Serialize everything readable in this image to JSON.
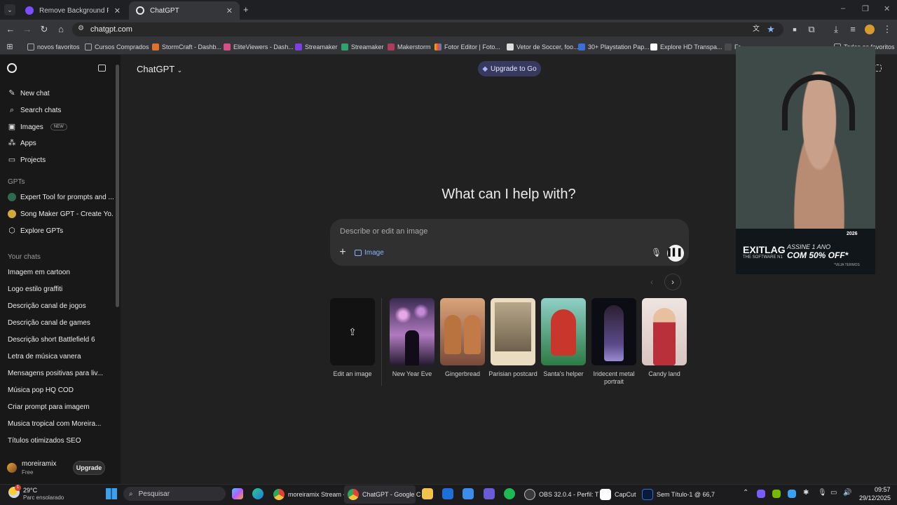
{
  "browser": {
    "tabs": [
      {
        "title": "Remove Background From Pho",
        "favicon_color": "#7c4dff",
        "active": false
      },
      {
        "title": "ChatGPT",
        "favicon_color": "#e8e8e8",
        "active": true
      }
    ],
    "new_tab": "+",
    "url": "chatgpt.com",
    "bookmarks": [
      {
        "label": "novos favoritos",
        "color": "#5f6368",
        "folder": true
      },
      {
        "label": "Cursos Comprados",
        "color": "#5f6368",
        "folder": true
      },
      {
        "label": "StormCraft - Dashb...",
        "color": "#e0712b"
      },
      {
        "label": "EliteViewers - Dash...",
        "color": "#d94d8a"
      },
      {
        "label": "Streamaker",
        "color": "#7b3fe4"
      },
      {
        "label": "Streamaker",
        "color": "#2fa36b"
      },
      {
        "label": "Makerstorm",
        "color": "#b03a5b"
      },
      {
        "label": "Fotor Editor | Foto...",
        "color": "#f2b705"
      },
      {
        "label": "Vetor de Soccer, foo...",
        "color": "#222222"
      },
      {
        "label": "30+ Playstation Pap...",
        "color": "#3a6fd8"
      },
      {
        "label": "Explore HD Transpa...",
        "color": "#ffffff"
      },
      {
        "label": "Fr...",
        "color": "#4a4a4a"
      },
      {
        "label": "Todos os favoritos",
        "color": "#5f6368",
        "folder": true
      }
    ]
  },
  "sidebar": {
    "nav": [
      {
        "label": "New chat",
        "icon": "edit-icon"
      },
      {
        "label": "Search chats",
        "icon": "search-icon"
      },
      {
        "label": "Images",
        "icon": "images-icon",
        "badge": "NEW"
      },
      {
        "label": "Apps",
        "icon": "apps-icon"
      },
      {
        "label": "Projects",
        "icon": "folder-icon"
      }
    ],
    "gpts_header": "GPTs",
    "gpts": [
      {
        "label": "Expert Tool for prompts and ...",
        "color": "#2c6b4f"
      },
      {
        "label": "Song Maker GPT - Create Yo...",
        "color": "#d4a73a"
      },
      {
        "label": "Explore GPTs",
        "color": ""
      }
    ],
    "chats_header": "Your chats",
    "chats": [
      "Imagem em cartoon",
      "Logo estilo graffiti",
      "Descrição canal de jogos",
      "Descrição canal de games",
      "Descrição short Battlefield 6",
      "Letra de música vanera",
      "Mensagens positivas para liv...",
      "Música pop HQ COD",
      "Criar prompt para imagem",
      "Musica tropical com Moreira...",
      "Títulos otimizados SEO"
    ],
    "user": {
      "name": "moreiramix",
      "plan": "Free",
      "upgrade": "Upgrade"
    }
  },
  "main": {
    "model": "ChatGPT",
    "upgrade_go": "Upgrade to Go",
    "hero": "What can I help with?",
    "composer": {
      "placeholder": "Describe or edit an image",
      "chip": "Image"
    },
    "cards": [
      {
        "label": "Edit an image"
      },
      {
        "label": "New Year Eve",
        "colors": [
          "#3a2a52",
          "#b07ac0"
        ]
      },
      {
        "label": "Gingerbread",
        "colors": [
          "#7a4a3a",
          "#d9a47a"
        ]
      },
      {
        "label": "Parisian postcard",
        "colors": [
          "#c9b99a",
          "#7a6a55"
        ]
      },
      {
        "label": "Santa's helper",
        "colors": [
          "#2e7a45",
          "#c9362c"
        ]
      },
      {
        "label": "Iridecent metal portrait",
        "colors": [
          "#0c0c14",
          "#5a4a8a"
        ]
      },
      {
        "label": "Candy land",
        "colors": [
          "#e9d9d6",
          "#b9303a"
        ]
      }
    ]
  },
  "overlay": {
    "ad_brand": "EXITLAG",
    "ad_tagline": "THE SOFTWARE N1",
    "ad_line1": "ASSINE 1 ANO",
    "ad_line2": "COM 50% OFF*",
    "ad_note": "*VEJA TERMOS",
    "ad_year": "2026"
  },
  "taskbar": {
    "weather": {
      "temp": "29°C",
      "desc": "Parc ensolarado",
      "badge": "1"
    },
    "search": "Pesquisar",
    "apps": [
      {
        "label": "moreiramix Stream -",
        "color": "#dba72b"
      },
      {
        "label": "ChatGPT - Google C",
        "color": "#dba72b"
      },
      {
        "label": "OBS 32.0.4 - Perfil: T",
        "color": "#555555"
      },
      {
        "label": "CapCut",
        "color": "#ffffff"
      },
      {
        "label": "Sem Título-1 @ 66,7",
        "color": "#2d6fd8"
      }
    ],
    "time": "09:57",
    "date": "29/12/2025"
  }
}
